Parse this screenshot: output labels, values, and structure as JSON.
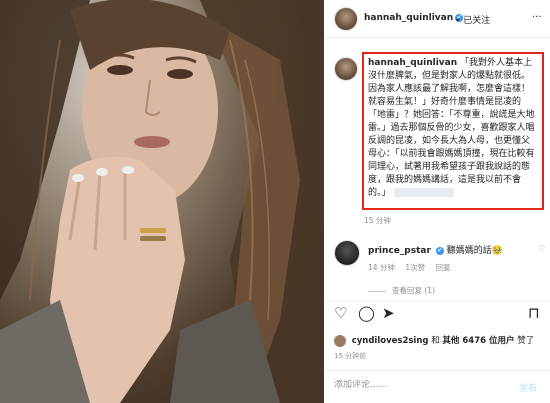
{
  "header": {
    "username": "hannah_quinlivan",
    "verified_mark": "✔",
    "separator": "•",
    "follow_status": "已关注",
    "more": "···"
  },
  "caption": {
    "username": "hannah_quinlivan",
    "text": "「我對外人基本上沒什麼脾氣，但是對家人的爆點就很低。因為家人應該最了解我啊，怎麼會這樣！就容易生氣！」好奇什麼事情是昆凌的「地雷」？她回答：「不尊重，說謊是大地雷。」過去那個反骨的少女，喜歡跟家人唱反調的昆凌，如今長大為人母，也更懂父母心：「以前我會跟媽媽頂撞，現在比較有同理心，試著用我希望孩子跟我說話的態度，跟我的媽媽講話，這是我以前不會的。」",
    "time": "15 分钟"
  },
  "comment": {
    "username": "prince_pstar",
    "text": "聽媽媽的話",
    "emoji": "🥹",
    "time": "14 分钟",
    "likes": "1次赞",
    "reply": "回复",
    "view_replies": "查看回复 (1)"
  },
  "likes": {
    "user": "cyndiloves2sing",
    "mid": "和",
    "others": "其他 6476 位用户",
    "suffix": "赞了"
  },
  "post_time": "15 分钟前",
  "comment_box": {
    "placeholder": "添加评论......",
    "post_label": "发布"
  },
  "icons": {
    "heart": "♡",
    "comment": "◯",
    "share": "➤",
    "bookmark": "⊓"
  }
}
